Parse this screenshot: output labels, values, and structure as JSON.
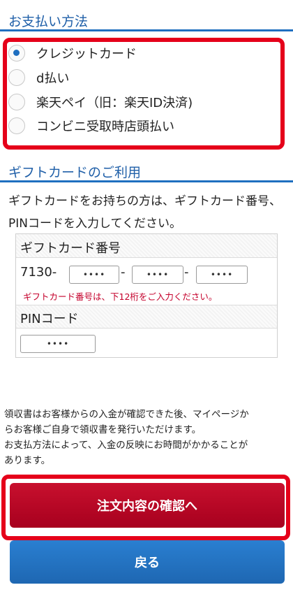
{
  "payment_section": {
    "title": "お支払い方法",
    "options": [
      {
        "label": "クレジットカード",
        "selected": true
      },
      {
        "label": "d払い",
        "selected": false
      },
      {
        "label": "楽天ペイ（旧：楽天ID決済)",
        "selected": false
      },
      {
        "label": "コンビニ受取時店頭払い",
        "selected": false
      }
    ]
  },
  "gift_section": {
    "title": "ギフトカードのご利用",
    "description": "ギフトカードをお持ちの方は、ギフトカード番号、PINコードを入力してください。",
    "card_number_label": "ギフトカード番号",
    "card_prefix": "7130-",
    "code_placeholder": "••••",
    "dash": "-",
    "card_number_note": "ギフトカード番号は、下12桁をご入力ください。",
    "pin_label": "PINコード",
    "pin_placeholder": "••••"
  },
  "notice_lines": [
    "領収書はお客様からの入金が確認できた後、マイページか",
    "らお客様ご自身で領収書を発行いただけます。",
    "お支払方法によって、入金の反映にお時間がかかることが",
    "あります。"
  ],
  "buttons": {
    "confirm": "注文内容の確認へ",
    "back": "戻る"
  },
  "colors": {
    "accent_blue": "#1f6fc0",
    "highlight_red": "#e5001a",
    "confirm_red": "#b8082a",
    "back_blue": "#2574c4",
    "note_red": "#c4002b"
  }
}
